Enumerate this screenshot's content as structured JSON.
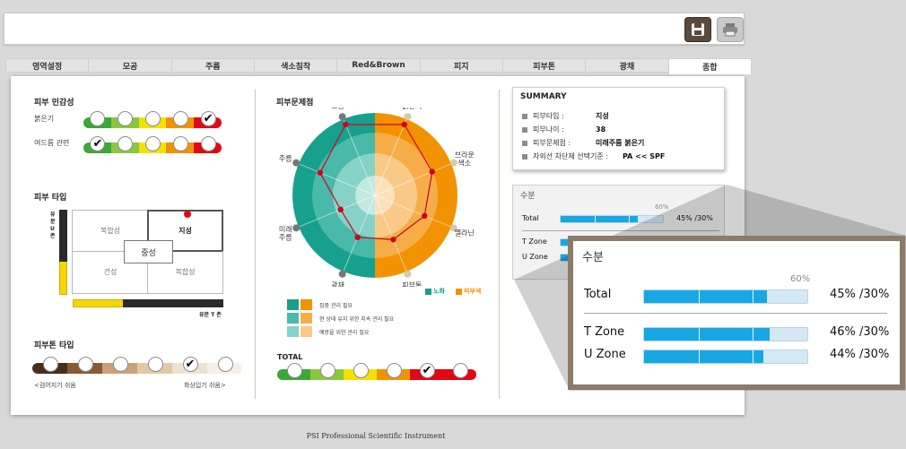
{
  "toolbar": {
    "save_icon": "save-icon",
    "print_icon": "printer-icon"
  },
  "tabs": [
    "영역설정",
    "모공",
    "주름",
    "색소침착",
    "Red&Brown",
    "피지",
    "피부톤",
    "광채",
    "종합"
  ],
  "active_tab": "종합",
  "sensitivity": {
    "title": "피부 민감성",
    "rows": [
      {
        "label": "붉은기",
        "checked_index": 4
      },
      {
        "label": "여드름 관련",
        "checked_index": 0
      }
    ],
    "scale_colors": [
      "#3aa935",
      "#8cc63f",
      "#f2e200",
      "#f39200",
      "#e30613"
    ]
  },
  "skin_type": {
    "title": "피부 타입",
    "y_axis_label": "유분 U 존",
    "x_axis_label": "유분 T 존",
    "cells": {
      "combo_top_left": "복합성",
      "oily": "지성",
      "neutral": "중성",
      "dry": "건성",
      "combo_bottom_right": "복합성"
    }
  },
  "skin_tone": {
    "title": "피부톤 타입",
    "checked_index": 4,
    "left_label": "<검어지기 쉬움",
    "right_label": "화상입기 쉬움>",
    "colors": [
      "#4a2e1c",
      "#8b5a34",
      "#c9a27a",
      "#e2c8a7",
      "#efe2d2",
      "#f6efe6"
    ]
  },
  "radar": {
    "title": "피부문제점",
    "axes": [
      "모공",
      "붉은기",
      "브라운\n색소",
      "멜라닌",
      "피부톤",
      "광채",
      "미래\n주름",
      "주름"
    ],
    "legend": [
      {
        "label": "노화",
        "color": "#17a08e"
      },
      {
        "label": "피부색",
        "color": "#f39200"
      }
    ],
    "levels": [
      "집중 관리 필요",
      "현 상태 유지 위한 지속 관리 필요",
      "예방을 위한 관리 필요"
    ],
    "total_label": "TOTAL",
    "total_checked_index": 4
  },
  "summary": {
    "title": "SUMMARY",
    "rows": [
      {
        "label": "피부타입 :",
        "value": "지성"
      },
      {
        "label": "피부나이 :",
        "value": "38"
      },
      {
        "label": "피부문제점 :",
        "value": "미래주름  붉은기"
      },
      {
        "label": "자외선 차단제 선택기준 :",
        "value": "PA << SPF"
      }
    ]
  },
  "moisture": {
    "title": "수분",
    "reference": "60%",
    "rows": [
      {
        "label": "Total",
        "value": 0.45,
        "text": "45% /30%"
      },
      {
        "label": "T Zone",
        "value": 0.46,
        "text": "46% /30%"
      },
      {
        "label": "U Zone",
        "value": 0.44,
        "text": "44% /30%"
      }
    ]
  },
  "footer": "PSI Professional Scientific Instrument"
}
